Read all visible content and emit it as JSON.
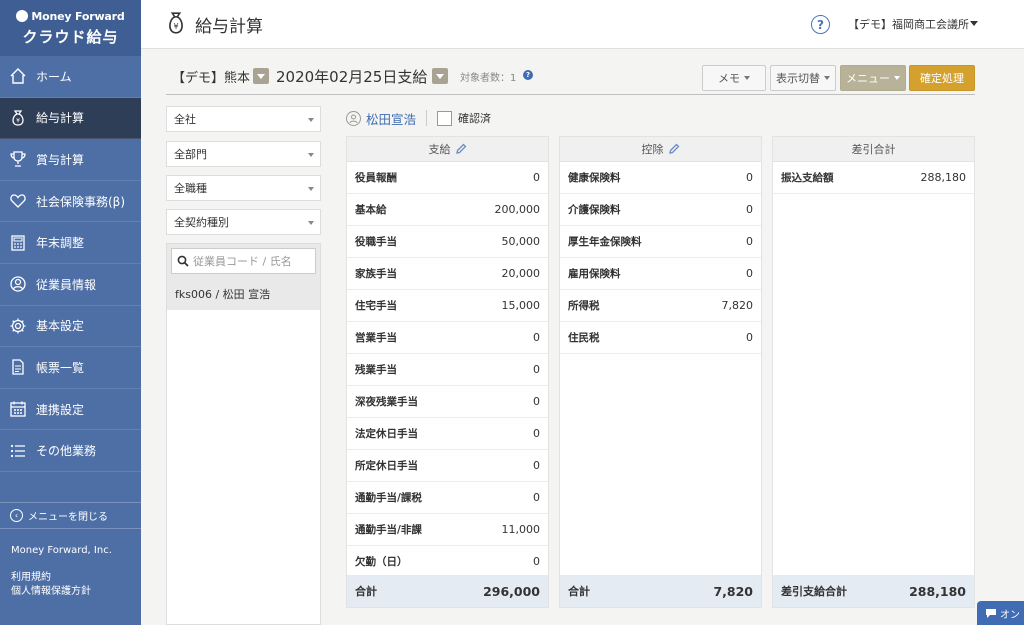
{
  "sidebar": {
    "brand_top": "Money Forward",
    "brand_sub": "クラウド給与",
    "items": [
      {
        "label": "ホーム"
      },
      {
        "label": "給与計算"
      },
      {
        "label": "賞与計算"
      },
      {
        "label": "社会保険事務(β)"
      },
      {
        "label": "年末調整"
      },
      {
        "label": "従業員情報"
      },
      {
        "label": "基本設定"
      },
      {
        "label": "帳票一覧"
      },
      {
        "label": "連携設定"
      },
      {
        "label": "その他業務"
      }
    ],
    "close_menu": "メニューを閉じる",
    "company": "Money Forward, Inc.",
    "terms": "利用規約",
    "privacy": "個人情報保護方針"
  },
  "header": {
    "title": "給与計算",
    "help": "?",
    "office": "【デモ】福岡商工会議所"
  },
  "toolbar": {
    "office": "【デモ】熊本",
    "pay_date": "2020年02月25日支給",
    "count": "対象者数：1",
    "count_icon": "?",
    "memo": "メモ",
    "view": "表示切替",
    "menu": "メニュー",
    "confirm": "確定処理"
  },
  "filters": [
    "全社",
    "全部門",
    "全職種",
    "全契約種別"
  ],
  "search": {
    "placeholder": "従業員コード / 氏名"
  },
  "employee_list": [
    {
      "label": "fks006 / 松田 宣浩"
    }
  ],
  "employee": {
    "name": "松田宣浩",
    "confirmed_label": "確認済"
  },
  "payments": {
    "title": "支給",
    "rows": [
      {
        "label": "役員報酬",
        "value": "0"
      },
      {
        "label": "基本給",
        "value": "200,000"
      },
      {
        "label": "役職手当",
        "value": "50,000"
      },
      {
        "label": "家族手当",
        "value": "20,000"
      },
      {
        "label": "住宅手当",
        "value": "15,000"
      },
      {
        "label": "営業手当",
        "value": "0"
      },
      {
        "label": "残業手当",
        "value": "0"
      },
      {
        "label": "深夜残業手当",
        "value": "0"
      },
      {
        "label": "法定休日手当",
        "value": "0"
      },
      {
        "label": "所定休日手当",
        "value": "0"
      },
      {
        "label": "通勤手当/課税",
        "value": "0"
      },
      {
        "label": "通勤手当/非課",
        "value": "11,000"
      },
      {
        "label": "欠勤（日）",
        "value": "0"
      }
    ],
    "total_label": "合計",
    "total_value": "296,000"
  },
  "deductions": {
    "title": "控除",
    "rows": [
      {
        "label": "健康保険料",
        "value": "0"
      },
      {
        "label": "介護保険料",
        "value": "0"
      },
      {
        "label": "厚生年金保険料",
        "value": "0"
      },
      {
        "label": "雇用保険料",
        "value": "0"
      },
      {
        "label": "所得税",
        "value": "7,820"
      },
      {
        "label": "住民税",
        "value": "0"
      }
    ],
    "total_label": "合計",
    "total_value": "7,820"
  },
  "net": {
    "title": "差引合計",
    "rows": [
      {
        "label": "振込支給額",
        "value": "288,180"
      }
    ],
    "total_label": "差引支給合計",
    "total_value": "288,180"
  },
  "chat": {
    "label": "オン"
  },
  "colors": {
    "sidebar": "#4e6fa6",
    "sidebar_active": "#2f3e57",
    "link": "#3f6cb3",
    "confirm": "#d4a12e",
    "menu_btn": "#b8b298"
  }
}
